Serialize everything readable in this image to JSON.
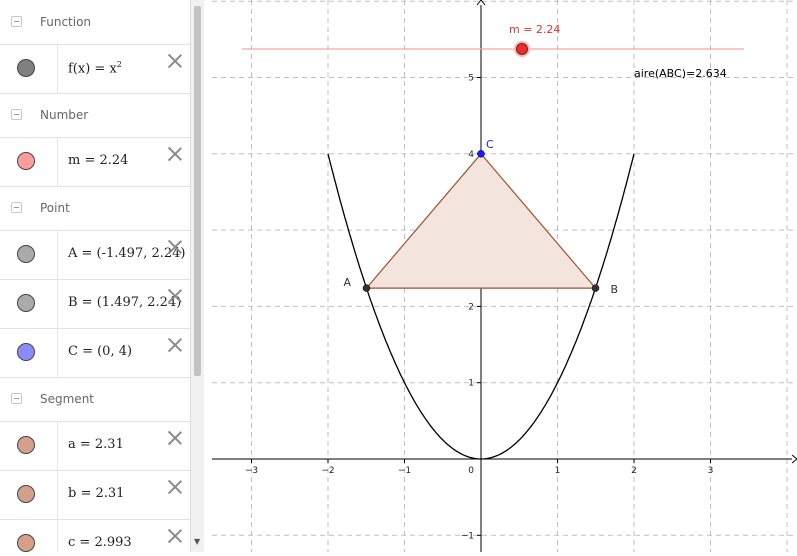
{
  "algebra": {
    "groups": [
      {
        "label": "Function",
        "items": [
          {
            "name": "f",
            "def": "f(x) = x",
            "sup": "2",
            "color": "#808080"
          }
        ]
      },
      {
        "label": "Number",
        "items": [
          {
            "name": "m",
            "def": "m = 2.24",
            "sup": "",
            "color": "#ff9d9d"
          }
        ]
      },
      {
        "label": "Point",
        "items": [
          {
            "name": "A",
            "def": "A = (-1.497, 2.24)",
            "sup": "",
            "color": "#aaaaaa"
          },
          {
            "name": "B",
            "def": "B = (1.497, 2.24)",
            "sup": "",
            "color": "#aaaaaa"
          },
          {
            "name": "C",
            "def": "C = (0, 4)",
            "sup": "",
            "color": "#8c8cff"
          }
        ]
      },
      {
        "label": "Segment",
        "items": [
          {
            "name": "a",
            "def": "a = 2.31",
            "sup": "",
            "color": "#d4a08a"
          },
          {
            "name": "b",
            "def": "b = 2.31",
            "sup": "",
            "color": "#d4a08a"
          },
          {
            "name": "c",
            "def": "c = 2.993",
            "sup": "",
            "color": "#d4a08a"
          }
        ]
      }
    ]
  },
  "graphics": {
    "x_ticks": [
      -3,
      -2,
      -1,
      1,
      2,
      3
    ],
    "y_ticks": [
      -1,
      1,
      2,
      3,
      4,
      5
    ],
    "origin_label": "0",
    "slider_label": "m = 2.24",
    "slider_value": 2.24,
    "area_text": "aire(ABC)=2.634",
    "points": [
      {
        "name": "A",
        "x": -1.497,
        "y": 2.24,
        "color": "#333333"
      },
      {
        "name": "B",
        "x": 1.497,
        "y": 2.24,
        "color": "#333333"
      },
      {
        "name": "C",
        "x": 0,
        "y": 4,
        "color": "#1a1aff"
      }
    ],
    "colors": {
      "triangle_fill": "#f3e4de",
      "triangle_stroke": "#a0522d",
      "slider": "#e53030",
      "curve": "#000000"
    }
  }
}
